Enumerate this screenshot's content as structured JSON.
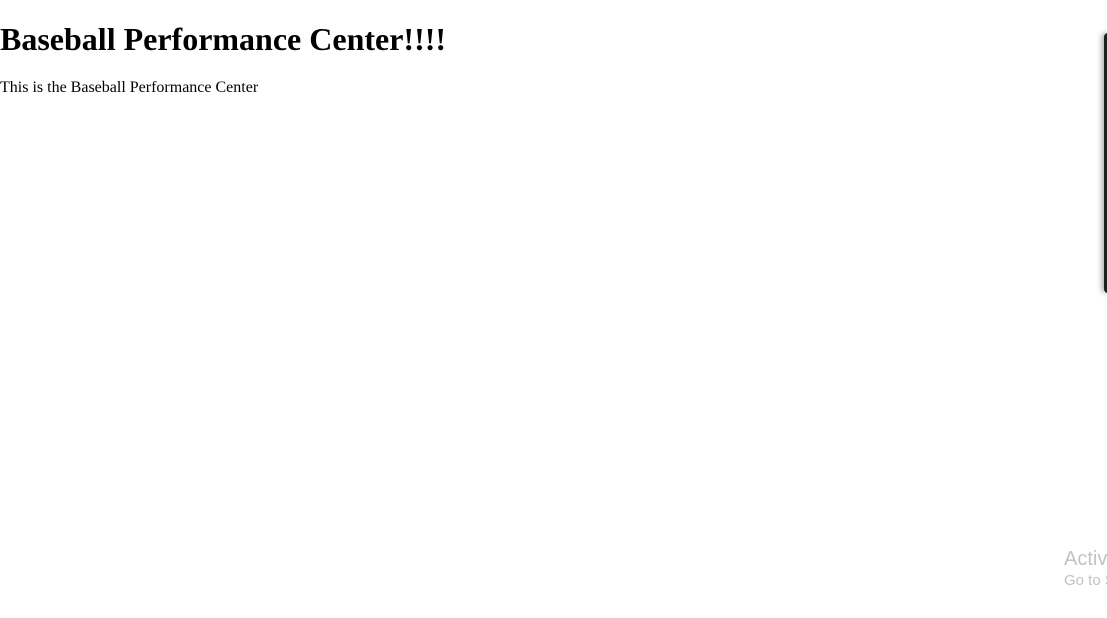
{
  "page": {
    "heading": "Baseball Performance Center!!!!",
    "intro": "This is the Baseball Performance Center"
  },
  "watermark": {
    "line1": "Activ",
    "line2": "Go to S"
  },
  "colors": {
    "background": "#ffffff",
    "text": "#000000",
    "watermark": "#c2c2c2",
    "panel_edge": "#1f1f1f"
  }
}
